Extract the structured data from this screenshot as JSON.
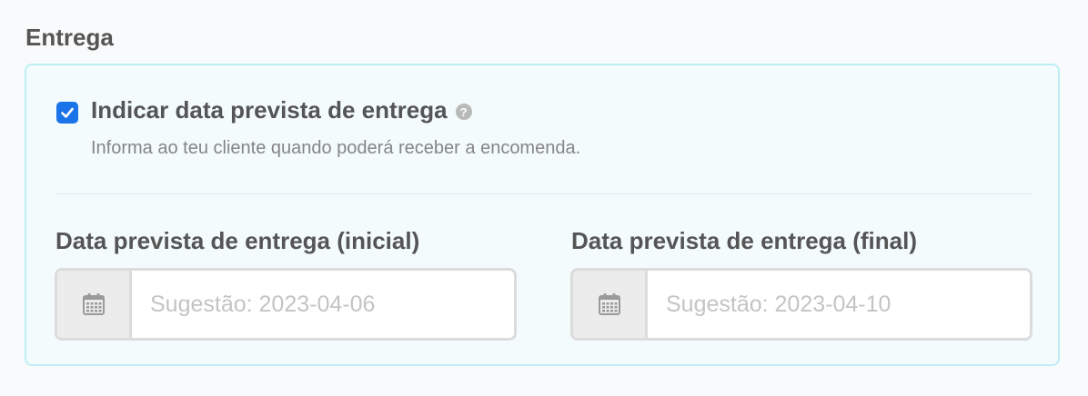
{
  "section": {
    "title": "Entrega"
  },
  "delivery_option": {
    "checked": true,
    "label": "Indicar data prevista de entrega",
    "help_icon": "question-circle-icon",
    "description": "Informa ao teu cliente quando poderá receber a encomenda."
  },
  "fields": [
    {
      "label": "Data prevista de entrega (inicial)",
      "icon": "calendar-icon",
      "value": "",
      "placeholder": "Sugestão: 2023-04-06"
    },
    {
      "label": "Data prevista de entrega (final)",
      "icon": "calendar-icon",
      "value": "",
      "placeholder": "Sugestão: 2023-04-10"
    }
  ],
  "colors": {
    "accent": "#1a73e8",
    "panel_background": "#f3fbfd",
    "panel_border": "#bdeff4"
  }
}
